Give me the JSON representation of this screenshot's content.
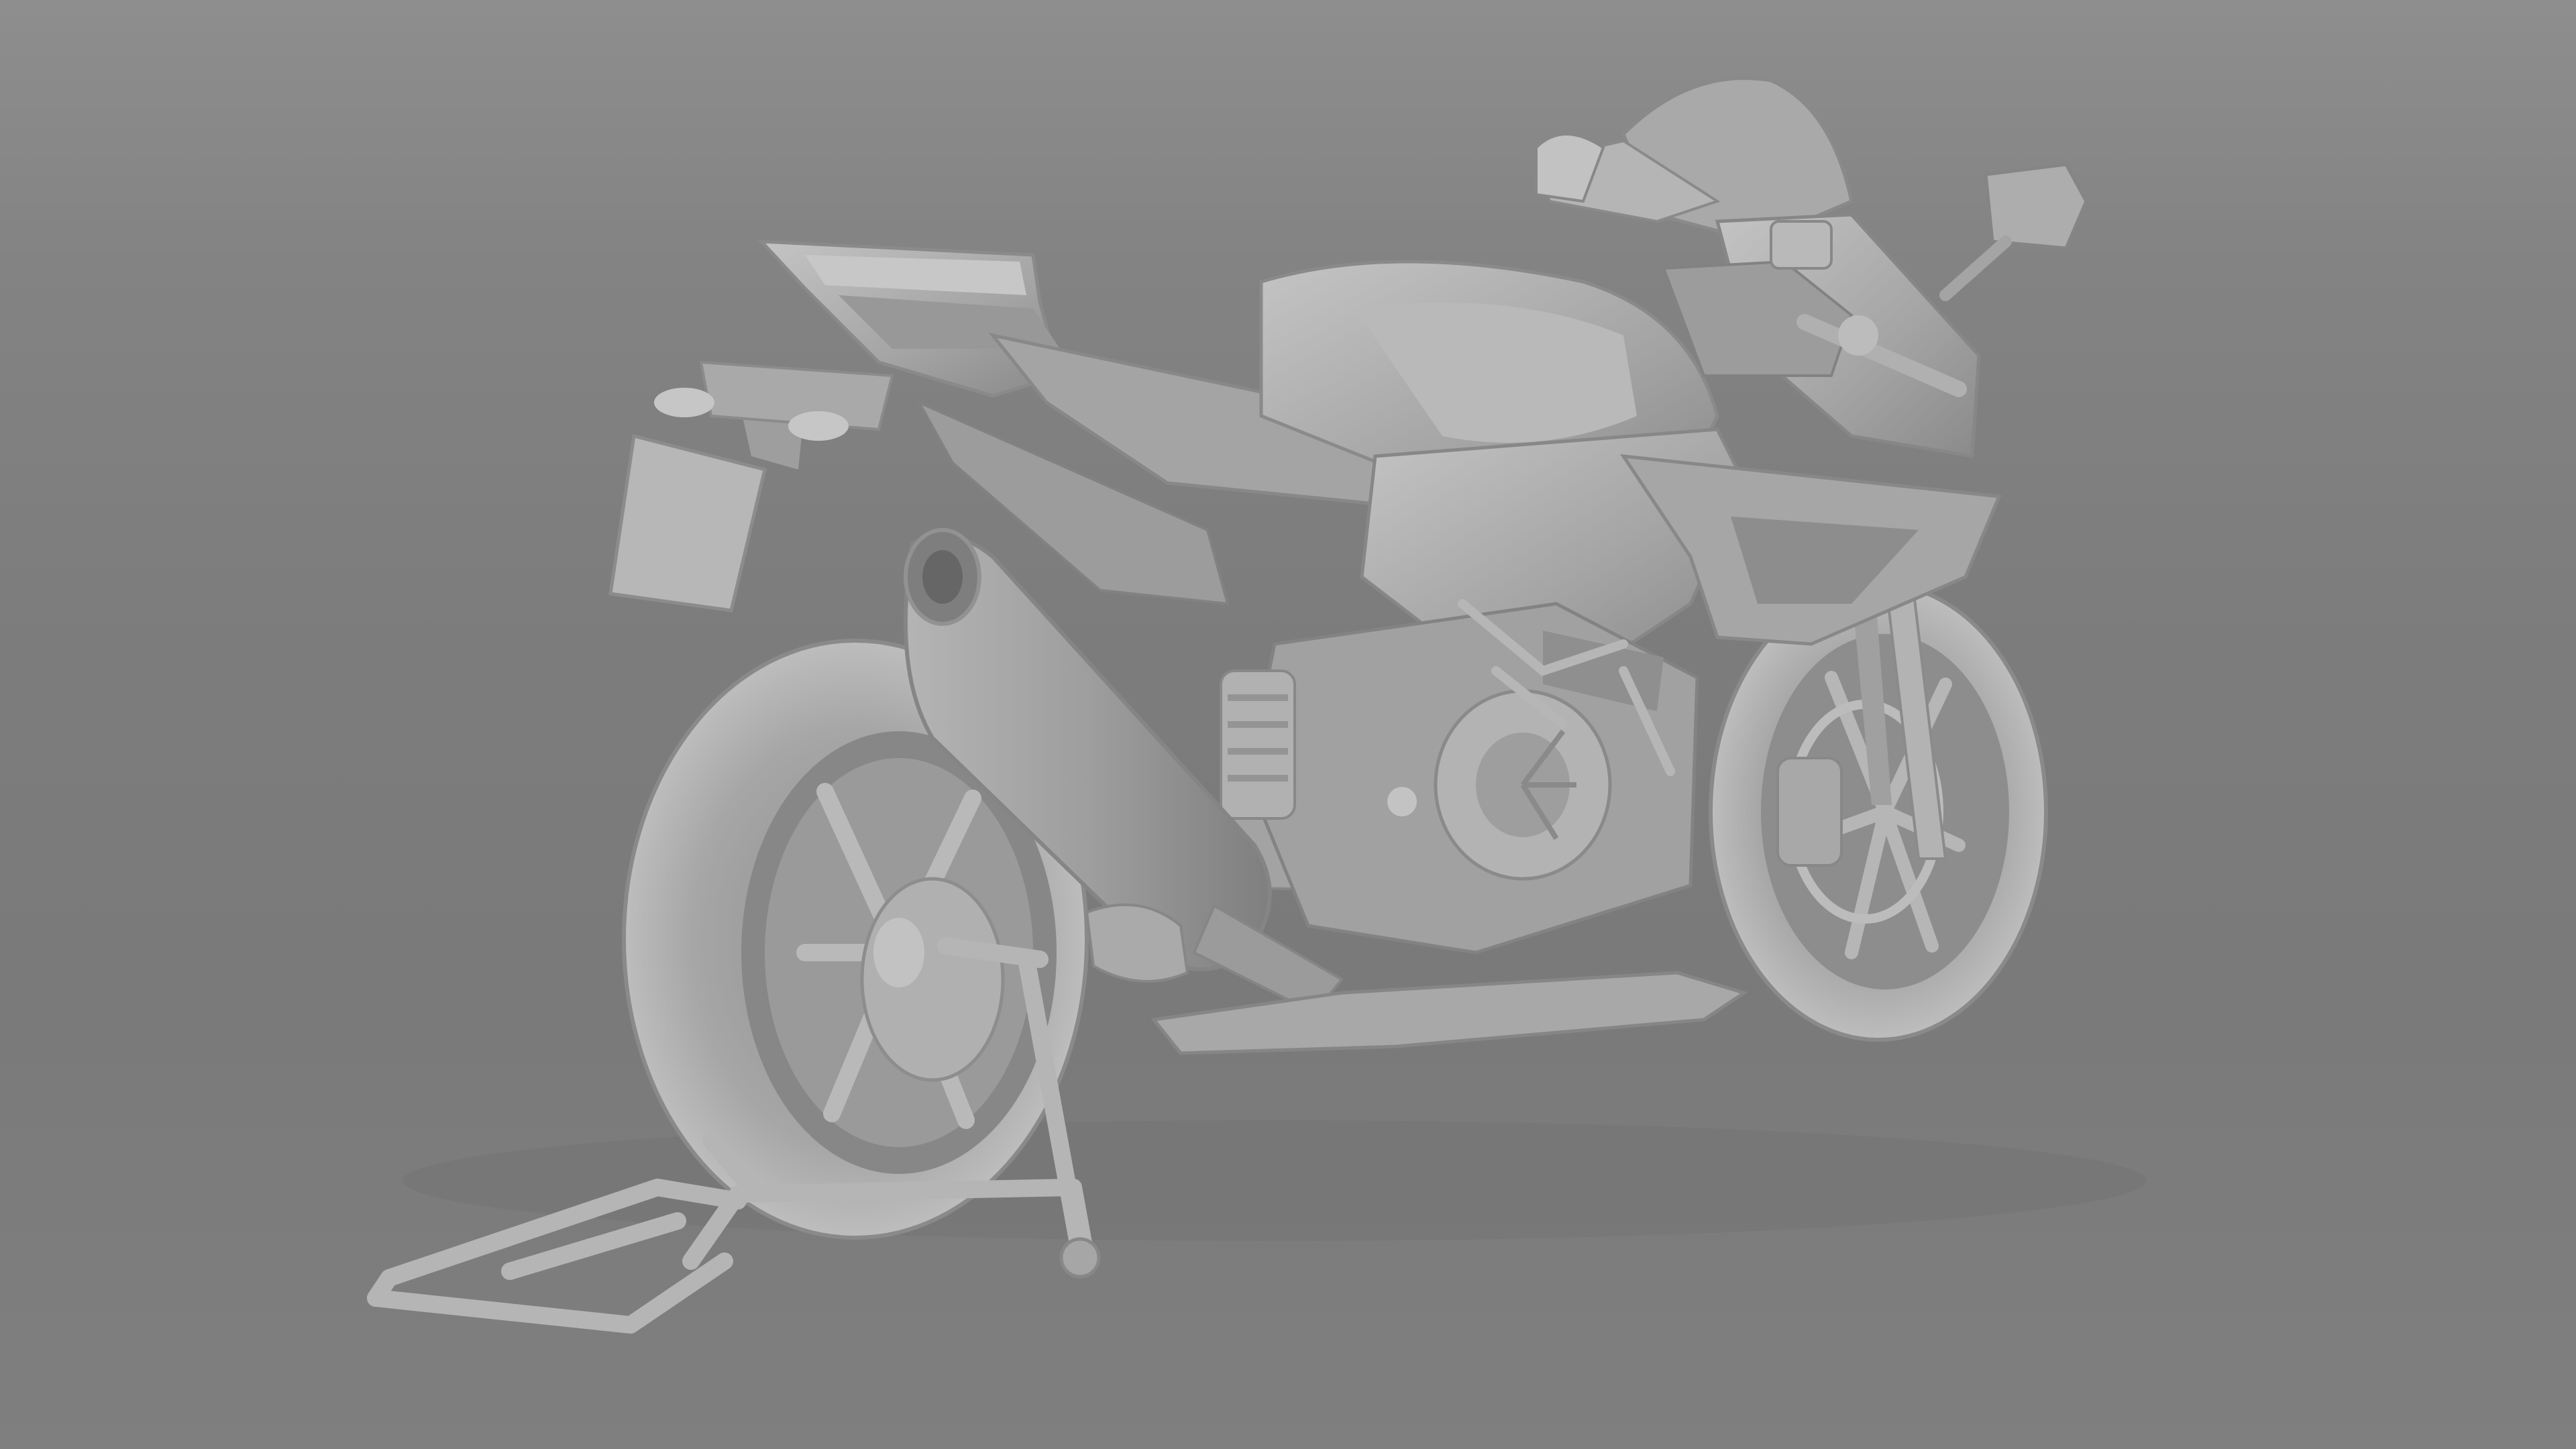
{
  "scene": {
    "subject": "motorcycle-3d-model-render",
    "background_color": "#7d7d7d",
    "model_color": "#a9a9a9",
    "shadow_color": "#5e5e5e",
    "highlight_color": "#cfcfcf"
  }
}
